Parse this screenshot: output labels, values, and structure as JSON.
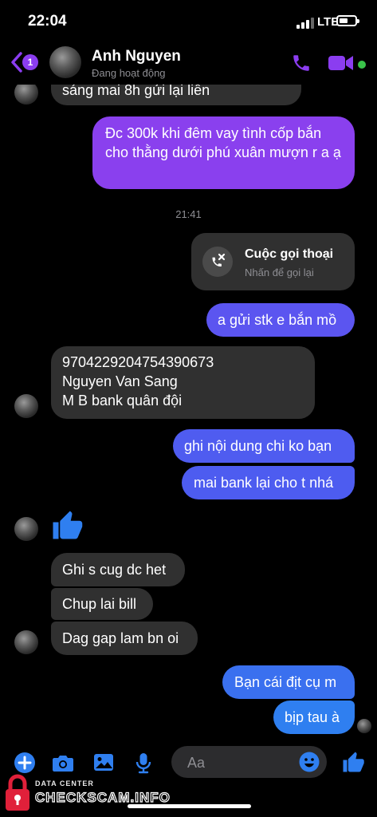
{
  "status": {
    "time": "22:04",
    "network": "LTE",
    "battery_level": 0.55
  },
  "header": {
    "back_badge": "1",
    "contact_name": "Anh Nguyen",
    "contact_status": "Đang hoạt động"
  },
  "messages": {
    "m0": "sáng mai 8h gửi lại liền",
    "m1": "Đc 300k khi đêm vay tình cốp bắn cho thằng dưới phú xuân mượn r a ạ",
    "time_divider": "21:41",
    "call_title": "Cuộc gọi thoại",
    "call_sub": "Nhấn để gọi lại",
    "m2": "a gửi stk e bắn mồ",
    "m3_line1": "9704229204754390673",
    "m3_line2": "Nguyen Van Sang",
    "m3_line3": "M B bank quân đội",
    "m4": "ghi nội dung chi ko bạn",
    "m5": "mai bank lại cho t nhá",
    "m6": "Ghi s cug dc het",
    "m7": "Chup lai bill",
    "m8": "Dag gap lam bn oi",
    "m9": "Bạn cái địt cụ m",
    "m10": "bịp tau à"
  },
  "composer": {
    "placeholder": "Aa"
  },
  "watermark": {
    "line1": "DATA CENTER",
    "line2": "CHECKSCAM.INFO"
  },
  "colors": {
    "accent": "#8b3df0",
    "bubble_in": "#303030",
    "bubble_out_purple": "#8a40ee",
    "bubble_out_blue": "#4d5cf0"
  }
}
